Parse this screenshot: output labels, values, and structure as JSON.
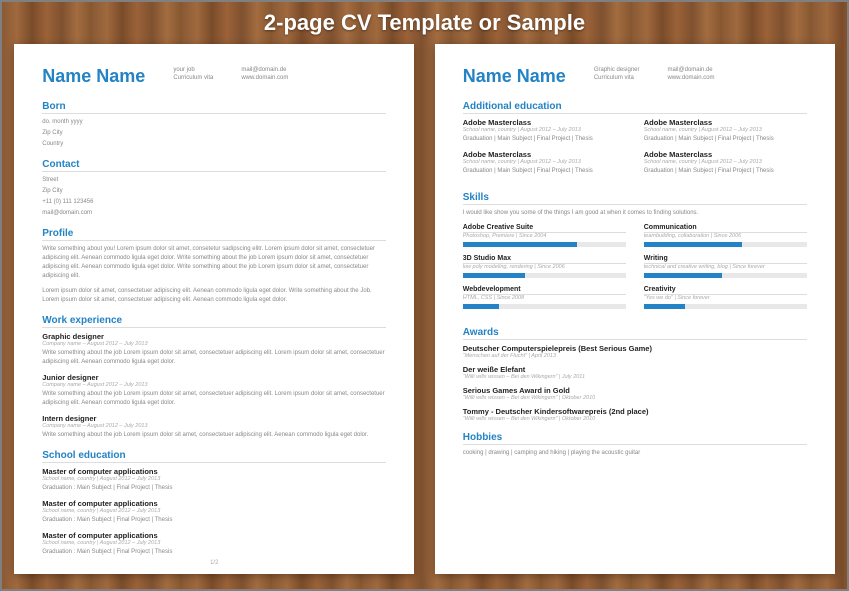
{
  "header": {
    "title": "2-page CV Template or Sample"
  },
  "page1": {
    "name": "Name Name",
    "col1": {
      "a": "your job",
      "b": "Curriculum vita"
    },
    "col2": {
      "a": "mail@domain.de",
      "b": "www.domain.com"
    },
    "born": {
      "title": "Born",
      "lines": [
        "do. month yyyy",
        "Zip City",
        "Country"
      ]
    },
    "contact": {
      "title": "Contact",
      "lines": [
        "Street",
        "Zip City",
        "+11 (0) 111 123456",
        "mail@domain.com"
      ]
    },
    "profile": {
      "title": "Profile",
      "p1": "Write something about you! Lorem ipsum dolor sit amet, consetetur sadipscing elitr. Lorem ipsum dolor sit amet, consectetuer adipiscing elit. Aenean commodo ligula eget dolor. Write something about the job Lorem ipsum dolor sit amet, consectetuer adipiscing elit. Aenean commodo ligula eget dolor. Write something about the job Lorem ipsum dolor sit amet, consectetuer adipiscing elit.",
      "p2": "Lorem ipsum dolor sit amet, consectetuer adipiscing elit. Aenean commodo ligula eget dolor. Write something about the Job. Lorem ipsum dolor sit amet, consectetuer adipiscing elit. Aenean commodo ligula eget dolor."
    },
    "work": {
      "title": "Work experience",
      "jobs": [
        {
          "role": "Graphic designer",
          "meta": "Company name – August 2012 – July 2013",
          "desc": "Write something about the job Lorem ipsum dolor sit amet, consectetuer adipiscing elit. Lorem ipsum dolor sit amet, consectetuer adipiscing elit. Aenean commodo ligula eget dolor."
        },
        {
          "role": "Junior designer",
          "meta": "Company name – August 2012 – July 2013",
          "desc": "Write something about the job Lorem ipsum dolor sit amet, consectetuer adipiscing elit. Lorem ipsum dolor sit amet, consectetuer adipiscing elit. Aenean commodo ligula eget dolor."
        },
        {
          "role": "Intern designer",
          "meta": "Company name – August 2012 – July 2013",
          "desc": "Write something about the job Lorem ipsum dolor sit amet, consectetuer adipiscing elit. Aenean commodo ligula eget dolor."
        }
      ]
    },
    "school": {
      "title": "School education",
      "items": [
        {
          "name": "Master of computer applications",
          "meta": "School name, country | August 2012 – July 2013",
          "grad": "Graduation : Main Subject | Final Project | Thesis"
        },
        {
          "name": "Master of computer applications",
          "meta": "School name, country | August 2012 – July 2013",
          "grad": "Graduation : Main Subject | Final Project | Thesis"
        },
        {
          "name": "Master of computer applications",
          "meta": "School name, country | August 2012 – July 2013",
          "grad": "Graduation : Main Subject | Final Project | Thesis"
        }
      ]
    },
    "pagenum": "1/2"
  },
  "page2": {
    "name": "Name Name",
    "col1": {
      "a": "Graphic designer",
      "b": "Curriculum vita"
    },
    "col2": {
      "a": "mail@domain.de",
      "b": "www.domain.com"
    },
    "addedu": {
      "title": "Additional education",
      "left": [
        {
          "name": "Adobe Masterclass",
          "meta": "School name, country | August 2012 – July 2013",
          "grad": "Graduation | Main Subject | Final Project | Thesis"
        },
        {
          "name": "Adobe Masterclass",
          "meta": "School name, country | August 2012 – July 2013",
          "grad": "Graduation | Main Subject | Final Project | Thesis"
        }
      ],
      "right": [
        {
          "name": "Adobe Masterclass",
          "meta": "School name, country | August 2012 – July 2013",
          "grad": "Graduation | Main Subject | Final Project | Thesis"
        },
        {
          "name": "Adobe Masterclass",
          "meta": "School name, country | August 2012 – July 2013",
          "grad": "Graduation | Main Subject | Final Project | Thesis"
        }
      ]
    },
    "skills": {
      "title": "Skills",
      "intro": "I would like show you some of the things I am good at when it comes to finding solutions.",
      "left": [
        {
          "name": "Adobe Creative Suite",
          "meta": "Photoshop, Premiere | Since 2004",
          "pct": 70
        },
        {
          "name": "3D Studio Max",
          "meta": "low poly modeling, rendering | Since 2006",
          "pct": 38
        },
        {
          "name": "Webdevelopment",
          "meta": "HTML, CSS | Since 2008",
          "pct": 22
        }
      ],
      "right": [
        {
          "name": "Communication",
          "meta": "teambuilding, collaboration | Since 2006",
          "pct": 60
        },
        {
          "name": "Writing",
          "meta": "technical and creative writing, blog | Since forever",
          "pct": 48
        },
        {
          "name": "Creativity",
          "meta": "“Yes we do” | Since forever",
          "pct": 25
        }
      ]
    },
    "awards": {
      "title": "Awards",
      "items": [
        {
          "name": "Deutscher Computerspielepreis (Best Serious Game)",
          "meta": "“Menschen auf der Flucht” | April 2013"
        },
        {
          "name": "Der weiße Elefant",
          "meta": "“Willi wills wissen – Bei den Wikingern” | July 2011"
        },
        {
          "name": "Serious Games Award in Gold",
          "meta": "“Willi wills wissen – Bei den Wikingern” | Oktober 2010"
        },
        {
          "name": "Tommy - Deutscher Kindersoftwarepreis (2nd place)",
          "meta": "“Willi wills wissen – Bei den Wikingern” | Oktober 2010"
        }
      ]
    },
    "hobbies": {
      "title": "Hobbies",
      "text": "cooking | drawing | camping and hiking | playing the acoustic guitar"
    }
  }
}
